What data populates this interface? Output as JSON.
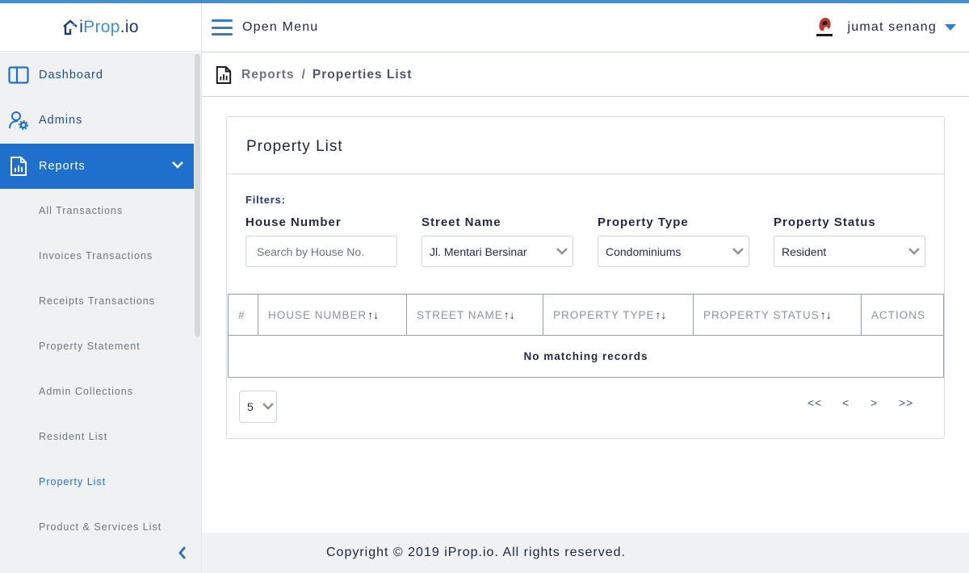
{
  "brand": {
    "logo_part1": "i",
    "logo_part2": "Prop",
    "logo_part3": ".io",
    "accent_color": "#1f6fcd",
    "top_bar_color": "#3f8fd2"
  },
  "header": {
    "menu_icon": "hamburger-icon",
    "open_menu_label": "Open Menu",
    "user_avatar_icon": "spartan-avatar-icon",
    "username": "jumat senang",
    "user_caret_icon": "caret-down-icon"
  },
  "sidebar": {
    "items": [
      {
        "label": "Dashboard",
        "icon": "dashboard-icon"
      },
      {
        "label": "Admins",
        "icon": "admin-settings-icon"
      },
      {
        "label": "Reports",
        "icon": "report-file-icon",
        "active": true
      }
    ],
    "reports_submenu": [
      "All Transactions",
      "Invoices Transactions",
      "Receipts Transactions",
      "Property Statement",
      "Admin Collections",
      "Resident List",
      "Property List",
      "Product & Services List"
    ],
    "current_submenu": "Property List",
    "collapse_icon": "chevron-left-icon"
  },
  "breadcrumb": {
    "icon": "report-file-icon",
    "parent": "Reports",
    "separator": "/",
    "current": "Properties List"
  },
  "card": {
    "title": "Property List",
    "filters_label": "Filters:",
    "filters": {
      "house_number": {
        "label": "House Number",
        "placeholder": "Search by House No."
      },
      "street_name": {
        "label": "Street Name",
        "value": "Jl. Mentari Bersinar"
      },
      "property_type": {
        "label": "Property Type",
        "value": "Condominiums"
      },
      "property_status": {
        "label": "Property Status",
        "value": "Resident"
      }
    },
    "table": {
      "columns": [
        "#",
        "HOUSE NUMBER",
        "STREET NAME",
        "PROPERTY TYPE",
        "PROPERTY STATUS",
        "ACTIONS"
      ],
      "sort_glyph": "↑↓",
      "empty_message": "No matching records"
    },
    "page_size": "5",
    "pagination": {
      "first": "<<",
      "prev": "<",
      "next": ">",
      "last": ">>"
    }
  },
  "footer": {
    "text": "Copyright © 2019 iProp.io. All rights reserved."
  }
}
